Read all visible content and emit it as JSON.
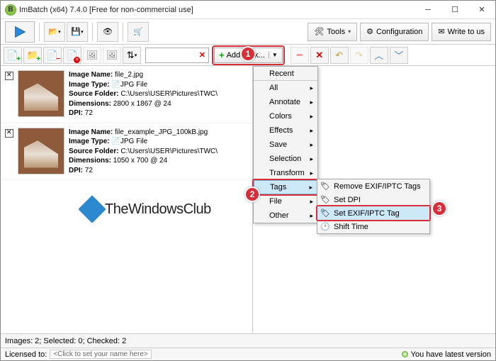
{
  "title": "ImBatch (x64) 7.4.0 [Free for non-commercial use]",
  "topbuttons": {
    "tools": "Tools",
    "config": "Configuration",
    "write": "Write to us"
  },
  "addtask": "Add Task...",
  "files": [
    {
      "name_label": "Image Name:",
      "name": "file_2.jpg",
      "type_label": "Image Type:",
      "type": "JPG File",
      "src_label": "Source Folder:",
      "src": "C:\\Users\\USER\\Pictures\\TWC\\",
      "dim_label": "Dimensions:",
      "dim": "2800 x 1867 @ 24",
      "dpi_label": "DPI:",
      "dpi": "72"
    },
    {
      "name_label": "Image Name:",
      "name": "file_example_JPG_100kB.jpg",
      "type_label": "Image Type:",
      "type": "JPG File",
      "src_label": "Source Folder:",
      "src": "C:\\Users\\USER\\Pictures\\TWC\\",
      "dim_label": "Dimensions:",
      "dim": "1050 x 700 @ 24",
      "dpi_label": "DPI:",
      "dpi": "72"
    }
  ],
  "menu": {
    "recent": "Recent",
    "all": "All",
    "annotate": "Annotate",
    "colors": "Colors",
    "effects": "Effects",
    "save": "Save",
    "selection": "Selection",
    "transform": "Transform",
    "tags": "Tags",
    "file": "File",
    "other": "Other"
  },
  "submenu": {
    "remove": "Remove EXIF/IPTC Tags",
    "setdpi": "Set DPI",
    "setexif": "Set EXIF/IPTC Tag",
    "shift": "Shift Time"
  },
  "callouts": {
    "c1": "1",
    "c2": "2",
    "c3": "3"
  },
  "watermark": "TheWindowsClub",
  "status1": "Images: 2; Selected: 0; Checked: 2",
  "status2_label": "Licensed to:",
  "status2_name": "<Click to set your name here>",
  "version": "You have latest version",
  "icons": {
    "folder": "📁"
  }
}
